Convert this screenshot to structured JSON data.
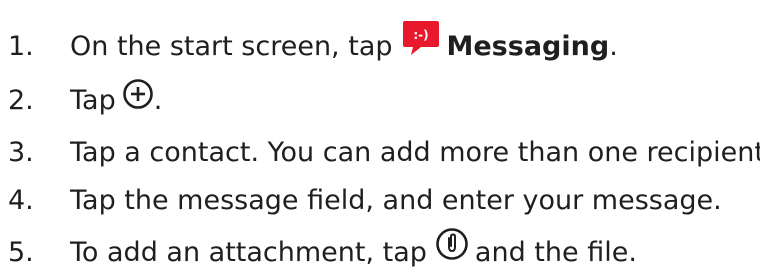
{
  "steps": [
    {
      "number": "1.",
      "before": "On the start screen, tap",
      "bold": "Messaging",
      "after": ".",
      "icon": "messaging-app-icon",
      "icon_text": ":-)",
      "icon_color": "#e8192c"
    },
    {
      "number": "2.",
      "before": "Tap",
      "after": ".",
      "icon": "plus-circle-icon"
    },
    {
      "number": "3.",
      "text": "Tap a contact. You can add more than one recipient."
    },
    {
      "number": "4.",
      "text": "Tap the message field, and enter your message."
    },
    {
      "number": "5.",
      "before": "To add an attachment, tap",
      "after": "and the file.",
      "icon": "attachment-circle-icon"
    }
  ]
}
